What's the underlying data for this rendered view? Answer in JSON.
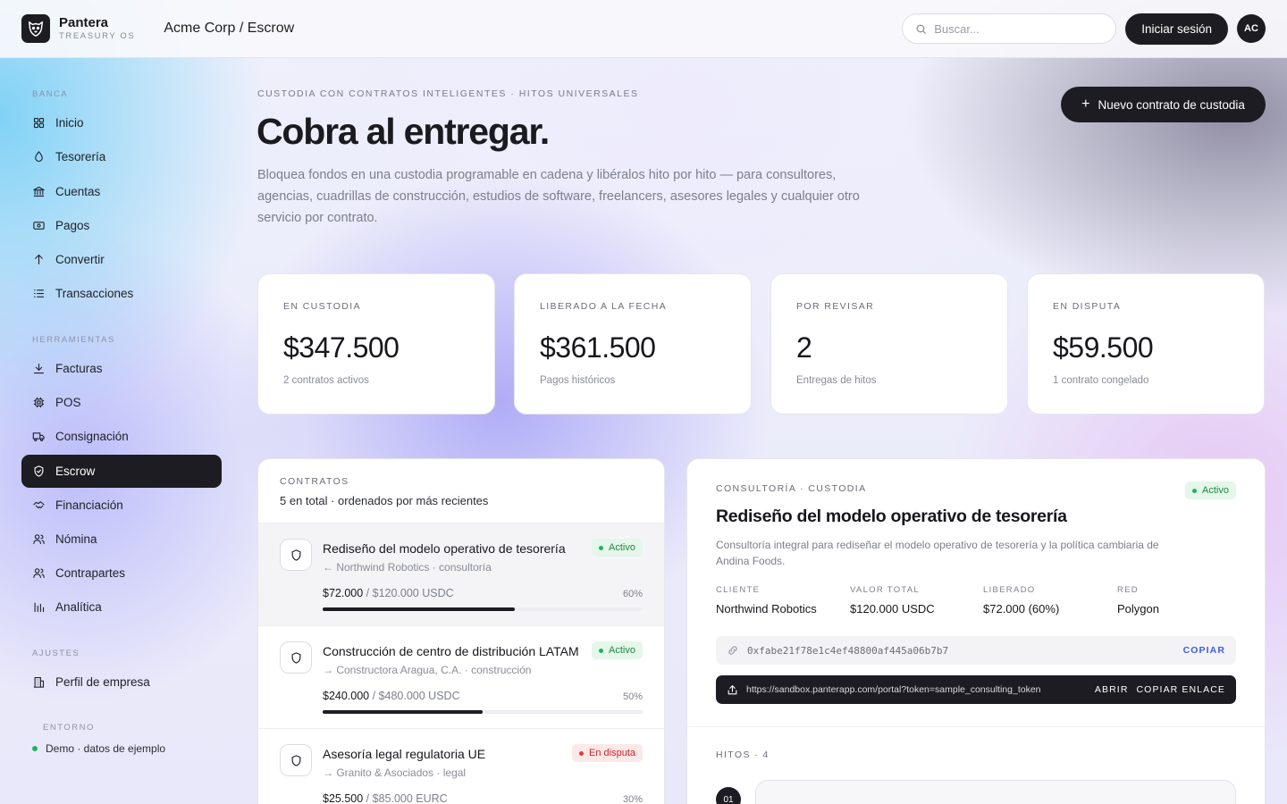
{
  "header": {
    "brand_name": "Pantera",
    "brand_sub": "TREASURY OS",
    "breadcrumb": "Acme Corp / Escrow",
    "search_placeholder": "Buscar...",
    "login_label": "Iniciar sesión",
    "avatar_initials": "AC"
  },
  "sidebar": {
    "sections": [
      "BANCA",
      "HERRAMIENTAS",
      "AJUSTES"
    ],
    "items": [
      {
        "label": "Inicio",
        "icon": "grid-icon"
      },
      {
        "label": "Tesorería",
        "icon": "drop-icon"
      },
      {
        "label": "Cuentas",
        "icon": "bank-icon"
      },
      {
        "label": "Pagos",
        "icon": "cash-icon"
      },
      {
        "label": "Convertir",
        "icon": "arrow-up-icon"
      },
      {
        "label": "Transacciones",
        "icon": "list-icon"
      },
      {
        "label": "Facturas",
        "icon": "download-icon"
      },
      {
        "label": "POS",
        "icon": "chip-icon"
      },
      {
        "label": "Consignación",
        "icon": "truck-icon"
      },
      {
        "label": "Escrow",
        "icon": "shield-icon"
      },
      {
        "label": "Financiación",
        "icon": "handshake-icon"
      },
      {
        "label": "Nómina",
        "icon": "users-icon"
      },
      {
        "label": "Contrapartes",
        "icon": "users-icon"
      },
      {
        "label": "Analítica",
        "icon": "bar-chart-icon"
      },
      {
        "label": "Perfil de empresa",
        "icon": "building-icon"
      }
    ],
    "active": "Escrow",
    "env_label": "ENTORNO",
    "env_value": "Demo · datos de ejemplo"
  },
  "hero": {
    "eyebrow": "CUSTODIA CON CONTRATOS INTELIGENTES · HITOS UNIVERSALES",
    "title": "Cobra al entregar.",
    "description": "Bloquea fondos en una custodia programable en cadena y libéralos hito por hito — para consultores, agencias, cuadrillas de construcción, estudios de software, freelancers, asesores legales y cualquier otro servicio por contrato.",
    "new_button": "Nuevo contrato de custodia"
  },
  "stats": [
    {
      "label": "EN CUSTODIA",
      "value": "$347.500",
      "sub": "2 contratos activos"
    },
    {
      "label": "LIBERADO A LA FECHA",
      "value": "$361.500",
      "sub": "Pagos históricos"
    },
    {
      "label": "POR REVISAR",
      "value": "2",
      "sub": "Entregas de hitos"
    },
    {
      "label": "EN DISPUTA",
      "value": "$59.500",
      "sub": "1 contrato congelado"
    }
  ],
  "contracts": {
    "label": "CONTRATOS",
    "summary": "5 en total · ordenados por más recientes",
    "rows": [
      {
        "title": "Rediseño del modelo operativo de tesorería",
        "meta": "← Northwind Robotics · consultoría",
        "status": "Activo",
        "released": "$72.000",
        "total": "/ $120.000 USDC",
        "pct_label": "60%",
        "progress": 0.6
      },
      {
        "title": "Construcción de centro de distribución LATAM",
        "meta": "→ Constructora Aragua, C.A. · construcción",
        "status": "Activo",
        "released": "$240.000",
        "total": "/ $480.000 USDC",
        "pct_label": "50%",
        "progress": 0.5
      },
      {
        "title": "Asesoría legal regulatoria UE",
        "meta": "→ Granito & Asociados · legal",
        "status": "En disputa",
        "released": "$25.500",
        "total": "/ $85.000 EURC",
        "pct_label": "30%",
        "progress": 0.3
      }
    ]
  },
  "detail": {
    "eyebrow": "CONSULTORÍA · CUSTODIA",
    "status": "Activo",
    "title": "Rediseño del modelo operativo de tesorería",
    "description": "Consultoría integral para rediseñar el modelo operativo de tesorería y la política cambiaria de Andina Foods.",
    "fields": [
      {
        "label": "CLIENTE",
        "value": "Northwind Robotics"
      },
      {
        "label": "VALOR TOTAL",
        "value": "$120.000 USDC"
      },
      {
        "label": "LIBERADO",
        "value": "$72.000 (60%)"
      },
      {
        "label": "RED",
        "value": "Polygon"
      }
    ],
    "address": "0xfabe21f78e1c4ef48800af445a06b7b7",
    "copy_label": "COPIAR",
    "portal_url": "https://sandbox.panterapp.com/portal?token=sample_consulting_token",
    "open_label": "ABRIR",
    "copy_link_label": "COPIAR ENLACE",
    "milestones_label": "HITOS · 4",
    "first_milestone_number": "01"
  },
  "colors": {
    "ink": "#1c1c22",
    "active_green": "#22b35b",
    "dispute_red": "#e23a3a",
    "link_blue": "#3d5ce0"
  }
}
